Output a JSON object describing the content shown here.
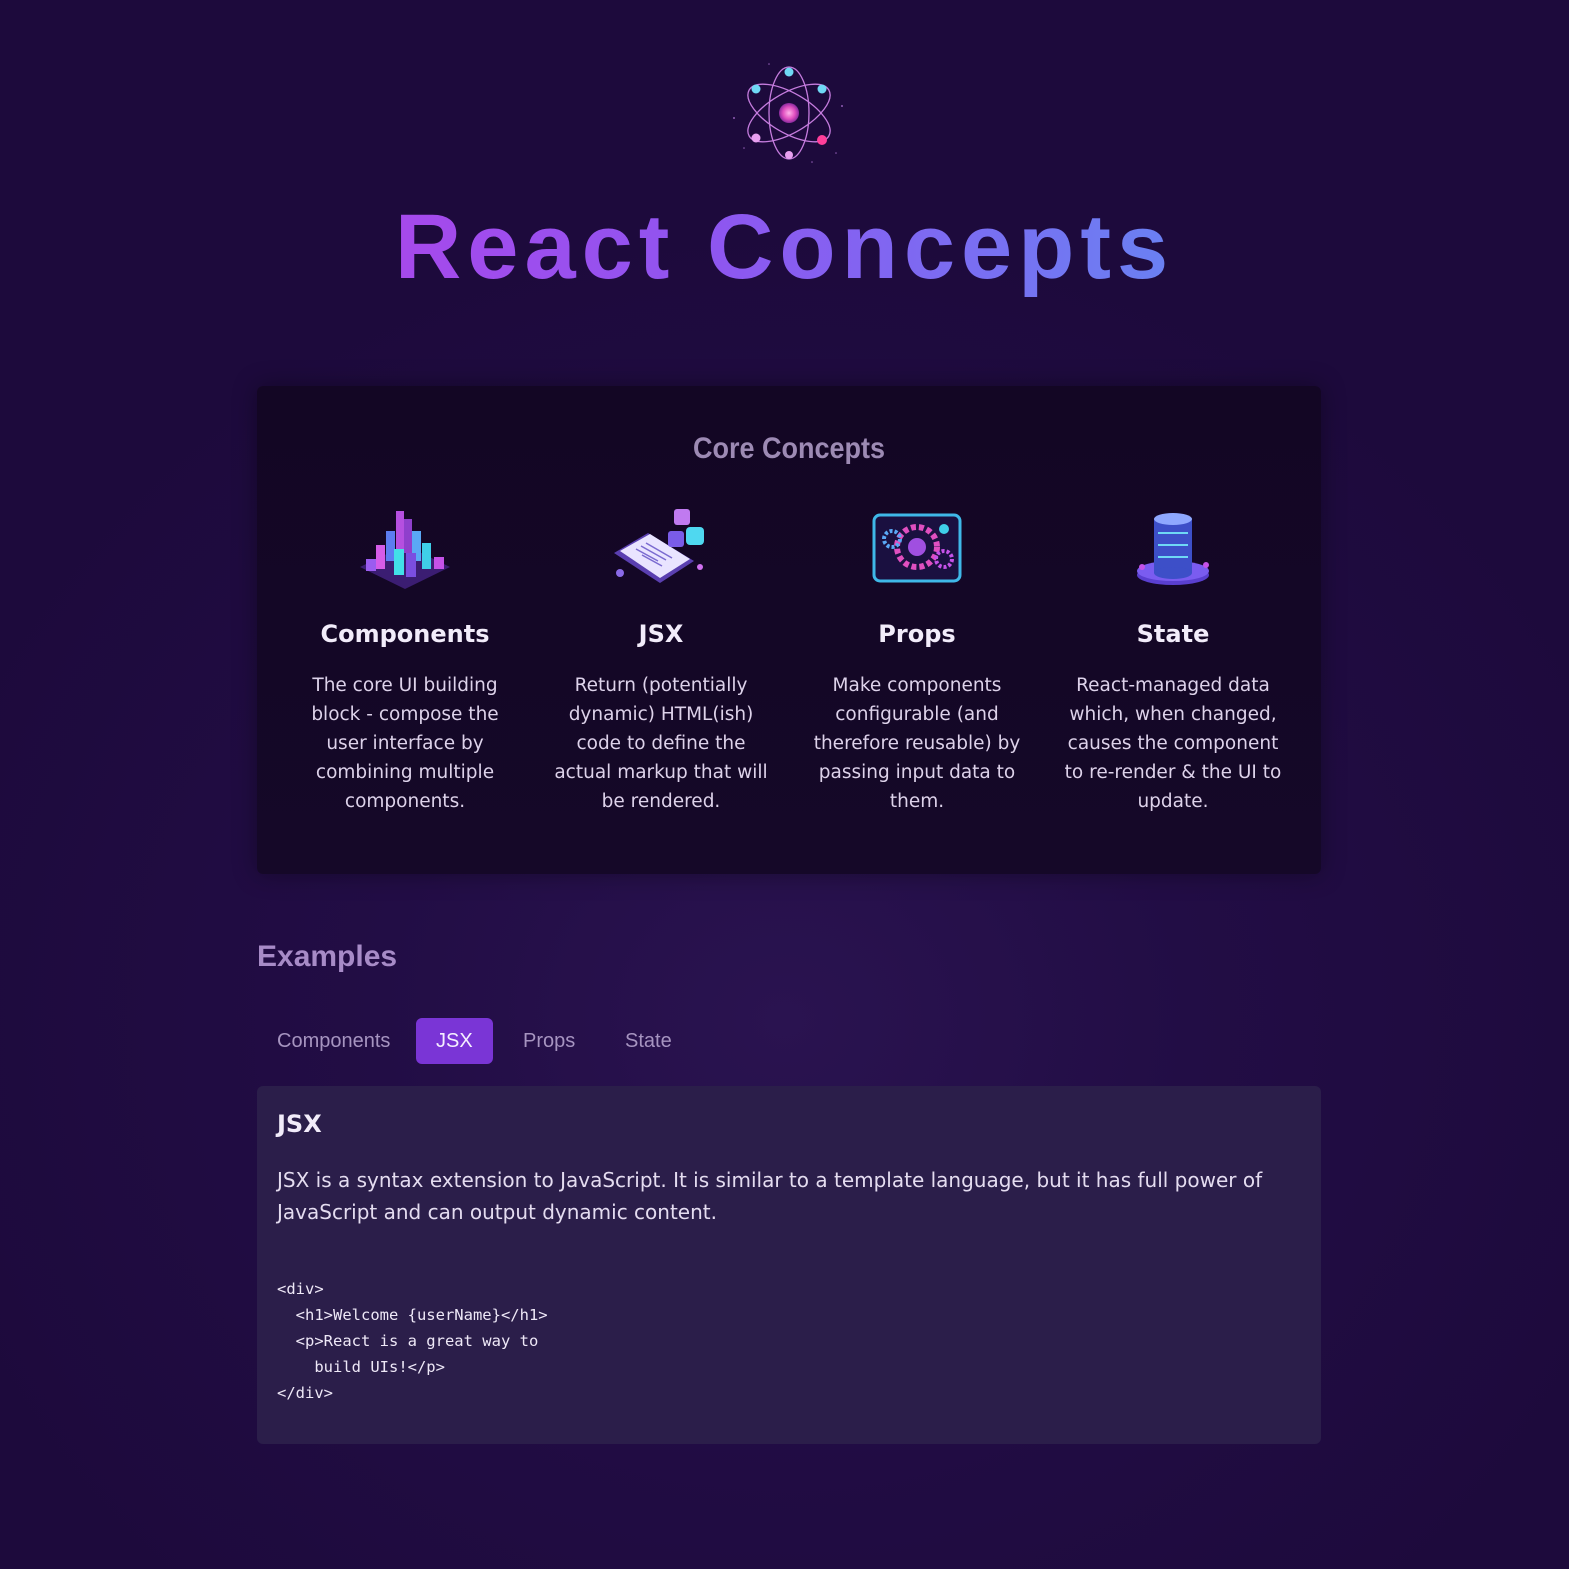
{
  "header": {
    "title": "React Concepts",
    "logo_icon": "react-atom-icon"
  },
  "core": {
    "title": "Core Concepts",
    "items": [
      {
        "title": "Components",
        "description": "The core UI building block - compose the user interface by combining multiple components.",
        "icon": "components-blocks-icon"
      },
      {
        "title": "JSX",
        "description": "Return (potentially dynamic) HTML(ish) code to define the actual markup that will be rendered.",
        "icon": "jsx-document-icon"
      },
      {
        "title": "Props",
        "description": "Make components configurable (and therefore reusable) by passing input data to them.",
        "icon": "props-gears-icon"
      },
      {
        "title": "State",
        "description": "React-managed data which, when changed, causes the component to re-render & the UI to update.",
        "icon": "state-database-icon"
      }
    ]
  },
  "examples": {
    "title": "Examples",
    "tabs": [
      "Components",
      "JSX",
      "Props",
      "State"
    ],
    "active_tab": "JSX",
    "content": {
      "title": "JSX",
      "description": "JSX is a syntax extension to JavaScript. It is similar to a template language, but it has full power of JavaScript and can output dynamic content.",
      "code": "<div>\n  <h1>Welcome {userName}</h1>\n  <p>React is a great way to\n    build UIs!</p>\n</div>"
    }
  },
  "colors": {
    "background": "#220d45",
    "accent": "#7a35d6",
    "title_gradient_start": "#c43ae6",
    "title_gradient_end": "#4aa6f5"
  }
}
